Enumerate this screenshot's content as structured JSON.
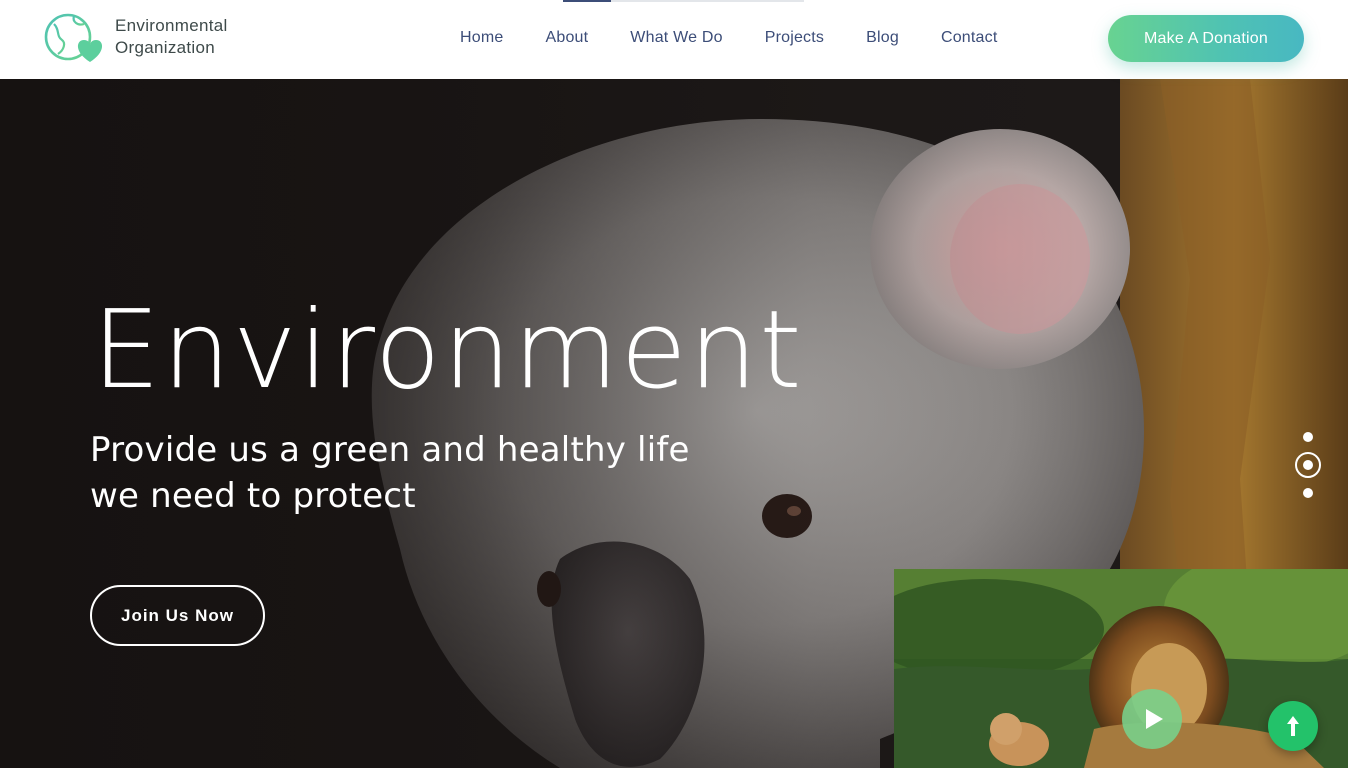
{
  "brand": {
    "line1": "Environmental",
    "line2": "Organization"
  },
  "nav": {
    "items": [
      {
        "label": "Home"
      },
      {
        "label": "About"
      },
      {
        "label": "What We Do"
      },
      {
        "label": "Projects"
      },
      {
        "label": "Blog"
      },
      {
        "label": "Contact"
      }
    ]
  },
  "donate_button": "Make A Donation",
  "hero": {
    "title": "Environment",
    "subtitle_line1": "Provide us a green and healthy life",
    "subtitle_line2": "we need to protect",
    "cta": "Join Us Now",
    "slide_count": 3,
    "active_slide": 2
  },
  "icons": {
    "logo": "globe-heart-icon",
    "play": "play-icon",
    "back_to_top": "arrow-up-icon"
  },
  "colors": {
    "nav_text": "#3c4d78",
    "donate_gradient_start": "#68d391",
    "donate_gradient_end": "#48b8c2",
    "back_to_top": "#23c26a"
  }
}
